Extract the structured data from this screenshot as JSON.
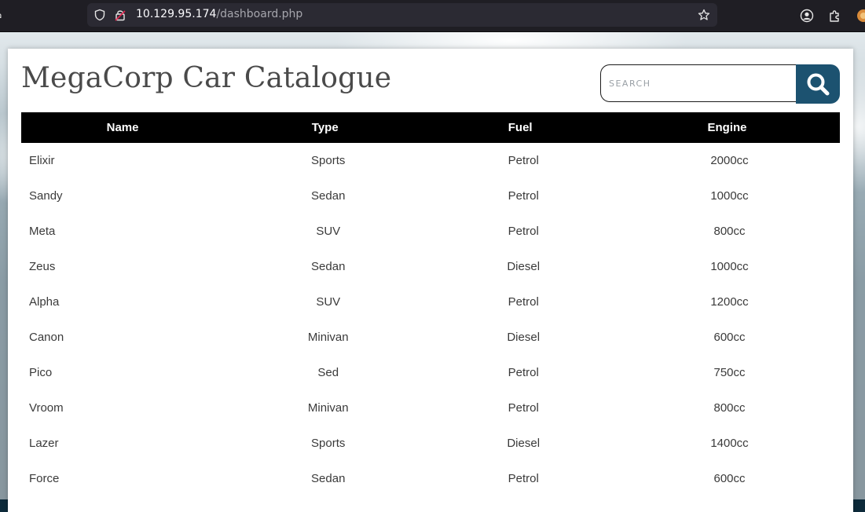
{
  "browser": {
    "url_host": "10.129.95.174",
    "url_path": "/dashboard.php",
    "icons": [
      "home-icon",
      "shield-icon",
      "insecure-lock-icon",
      "star-icon",
      "account-icon",
      "extensions-icon",
      "extension-avatar-icon"
    ]
  },
  "page": {
    "title": "MegaCorp Car Catalogue",
    "search": {
      "placeholder": "SEARCH",
      "value": "",
      "button_icon": "search-icon"
    },
    "colors": {
      "header_bg": "#000000",
      "search_button": "#1c5270",
      "title": "#4a4a4a"
    }
  },
  "table": {
    "headers": [
      "Name",
      "Type",
      "Fuel",
      "Engine"
    ],
    "rows": [
      [
        "Elixir",
        "Sports",
        "Petrol",
        "2000cc"
      ],
      [
        "Sandy",
        "Sedan",
        "Petrol",
        "1000cc"
      ],
      [
        "Meta",
        "SUV",
        "Petrol",
        "800cc"
      ],
      [
        "Zeus",
        "Sedan",
        "Diesel",
        "1000cc"
      ],
      [
        "Alpha",
        "SUV",
        "Petrol",
        "1200cc"
      ],
      [
        "Canon",
        "Minivan",
        "Diesel",
        "600cc"
      ],
      [
        "Pico",
        "Sed",
        "Petrol",
        "750cc"
      ],
      [
        "Vroom",
        "Minivan",
        "Petrol",
        "800cc"
      ],
      [
        "Lazer",
        "Sports",
        "Diesel",
        "1400cc"
      ],
      [
        "Force",
        "Sedan",
        "Petrol",
        "600cc"
      ]
    ]
  }
}
